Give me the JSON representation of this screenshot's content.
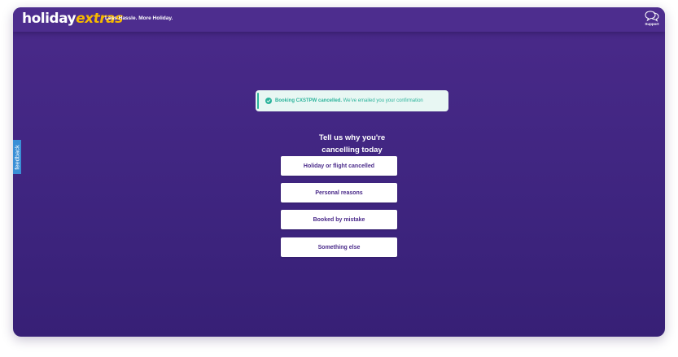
{
  "header": {
    "logo_part1": "holiday",
    "logo_part2": "extras",
    "tagline": "Less Hassle. More Holiday.",
    "support_label": "Support",
    "support_icon": "speech-bubbles-icon"
  },
  "feedback": {
    "label": "feedback"
  },
  "notice": {
    "icon": "check-circle-icon",
    "bold_text": "Booking CXSTPW cancelled.",
    "text": " We've emailed you your confirmation"
  },
  "heading": {
    "line1": "Tell us why you're",
    "line2": "cancelling today"
  },
  "reasons": [
    {
      "label": "Holiday or flight cancelled"
    },
    {
      "label": "Personal reasons"
    },
    {
      "label": "Booked by mistake"
    },
    {
      "label": "Something else"
    }
  ],
  "colors": {
    "brand_purple": "#4a2a8a",
    "logo_yellow": "#f5b800",
    "success_green": "#2bb39b",
    "notice_bg": "#e8f7f3",
    "feedback_blue": "#3a8fd6"
  }
}
